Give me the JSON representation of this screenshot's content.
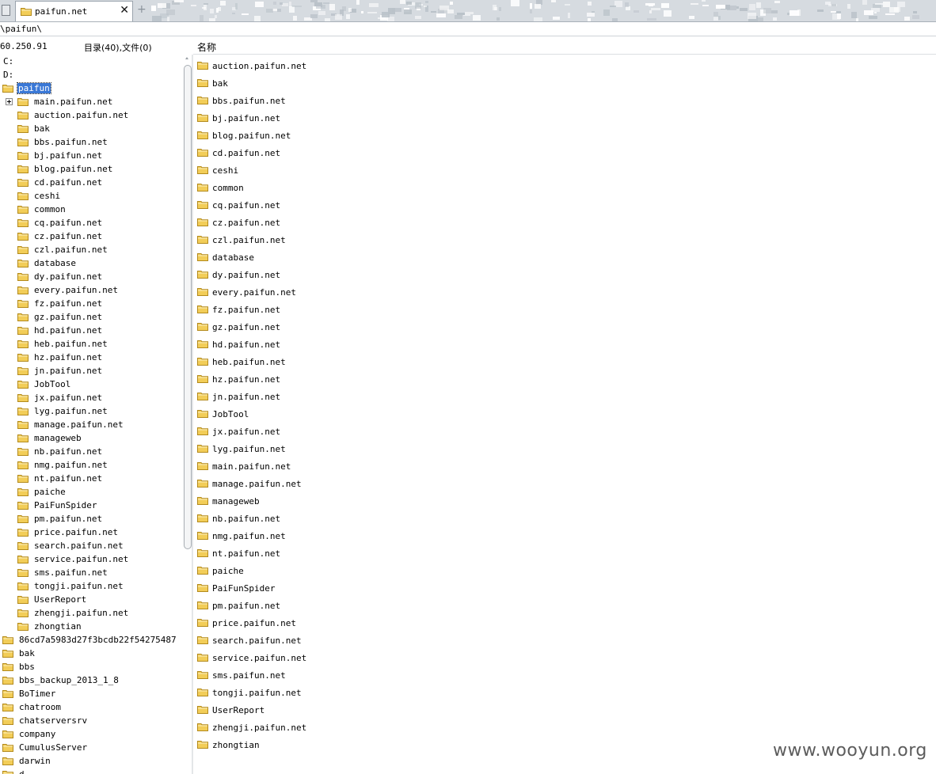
{
  "tab": {
    "label": "paifun.net",
    "close_glyph": "✕",
    "add_glyph": "+"
  },
  "path": "\\paifun\\",
  "info": {
    "ip_fragment": "60.250.91",
    "counts": "目录(40),文件(0)",
    "column_name": "名称"
  },
  "tree": {
    "drives": [
      "C:",
      "D:"
    ],
    "root": "paifun",
    "children": [
      "main.paifun.net",
      "auction.paifun.net",
      "bak",
      "bbs.paifun.net",
      "bj.paifun.net",
      "blog.paifun.net",
      "cd.paifun.net",
      "ceshi",
      "common",
      "cq.paifun.net",
      "cz.paifun.net",
      "czl.paifun.net",
      "database",
      "dy.paifun.net",
      "every.paifun.net",
      "fz.paifun.net",
      "gz.paifun.net",
      "hd.paifun.net",
      "heb.paifun.net",
      "hz.paifun.net",
      "jn.paifun.net",
      "JobTool",
      "jx.paifun.net",
      "lyg.paifun.net",
      "manage.paifun.net",
      "manageweb",
      "nb.paifun.net",
      "nmg.paifun.net",
      "nt.paifun.net",
      "paiche",
      "PaiFunSpider",
      "pm.paifun.net",
      "price.paifun.net",
      "search.paifun.net",
      "service.paifun.net",
      "sms.paifun.net",
      "tongji.paifun.net",
      "UserReport",
      "zhengji.paifun.net",
      "zhongtian"
    ],
    "siblings": [
      "86cd7a5983d27f3bcdb22f54275487",
      "bak",
      "bbs",
      "bbs_backup_2013_1_8",
      "BoTimer",
      "chatroom",
      "chatserversrv",
      "company",
      "CumulusServer",
      "darwin",
      "d"
    ]
  },
  "list": [
    "auction.paifun.net",
    "bak",
    "bbs.paifun.net",
    "bj.paifun.net",
    "blog.paifun.net",
    "cd.paifun.net",
    "ceshi",
    "common",
    "cq.paifun.net",
    "cz.paifun.net",
    "czl.paifun.net",
    "database",
    "dy.paifun.net",
    "every.paifun.net",
    "fz.paifun.net",
    "gz.paifun.net",
    "hd.paifun.net",
    "heb.paifun.net",
    "hz.paifun.net",
    "jn.paifun.net",
    "JobTool",
    "jx.paifun.net",
    "lyg.paifun.net",
    "main.paifun.net",
    "manage.paifun.net",
    "manageweb",
    "nb.paifun.net",
    "nmg.paifun.net",
    "nt.paifun.net",
    "paiche",
    "PaiFunSpider",
    "pm.paifun.net",
    "price.paifun.net",
    "search.paifun.net",
    "service.paifun.net",
    "sms.paifun.net",
    "tongji.paifun.net",
    "UserReport",
    "zhengji.paifun.net",
    "zhongtian"
  ],
  "watermark": "www.wooyun.org",
  "colors": {
    "folder": "#f2cd58",
    "folder_edge": "#b38a1c",
    "selection": "#3a78d6"
  }
}
